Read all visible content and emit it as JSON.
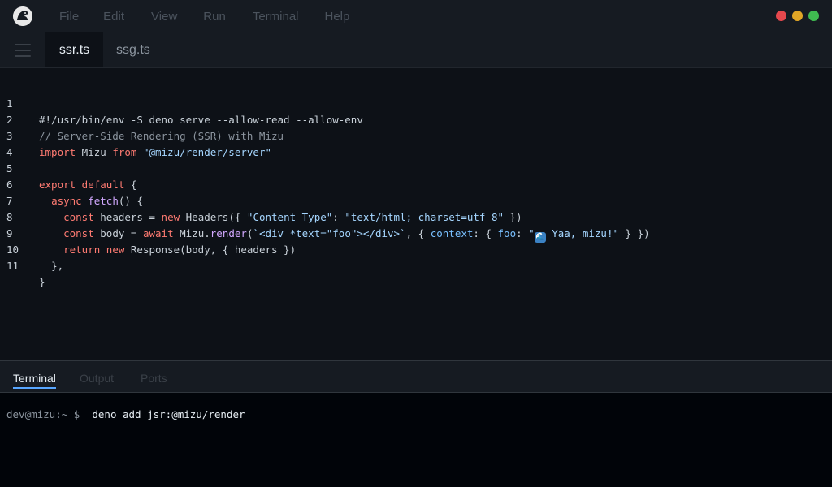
{
  "menu": [
    "File",
    "Edit",
    "View",
    "Run",
    "Terminal",
    "Help"
  ],
  "tabs": {
    "active": "ssr.ts",
    "inactive": "ssg.ts"
  },
  "editor": {
    "line_numbers": [
      "1",
      "2",
      "3",
      "4",
      "5",
      "6",
      "7",
      "8",
      "9",
      "10",
      "11"
    ],
    "l1": "#!/usr/bin/env -S deno serve --allow-read --allow-env",
    "l2": "// Server-Side Rendering (SSR) with Mizu",
    "l3": {
      "k1": "import",
      "t1": " Mizu ",
      "k2": "from",
      "t2": " ",
      "s1": "\"@mizu/render/server\""
    },
    "l5": {
      "k1": "export default",
      "t1": " {"
    },
    "l6": {
      "k1": "async",
      "t1": " ",
      "f1": "fetch",
      "t2": "() {"
    },
    "l7": {
      "k1": "const",
      "t1": " headers = ",
      "k2": "new",
      "t2": " Headers({ ",
      "s1": "\"Content-Type\"",
      "t3": ": ",
      "s2": "\"text/html; charset=utf-8\"",
      "t4": " })"
    },
    "l8": {
      "k1": "const",
      "t1": " body = ",
      "k2": "await",
      "t2": " Mizu.",
      "f1": "render",
      "t3": "(",
      "s1": "`<div *text=\"foo\"></div>`",
      "t4": ", { ",
      "p1": "context",
      "t5": ": { ",
      "p2": "foo",
      "t6": ": ",
      "s2a": "\"",
      "emoji": "🌊",
      "s2b": " Yaa, mizu!\"",
      "t7": " } })"
    },
    "l9": {
      "k1": "return",
      "t1": " ",
      "k2": "new",
      "t2": " Response(body, { headers })"
    },
    "l10": "},",
    "l11": "}"
  },
  "panel_tabs": [
    "Terminal",
    "Output",
    "Ports"
  ],
  "terminal": {
    "prompt": "dev@mizu:~ $",
    "command": "deno add jsr:@mizu/render"
  },
  "colors": {
    "keyword": "#ff7b72",
    "string": "#a5d6ff",
    "comment": "#8b949e",
    "function": "#d2a8ff",
    "property": "#79c0ff",
    "close": "#e5484d",
    "minimize": "#e1a626",
    "maximize": "#3fb950"
  },
  "icons": {
    "logo": "mizu-logo-icon",
    "menu": "hamburger-icon"
  }
}
